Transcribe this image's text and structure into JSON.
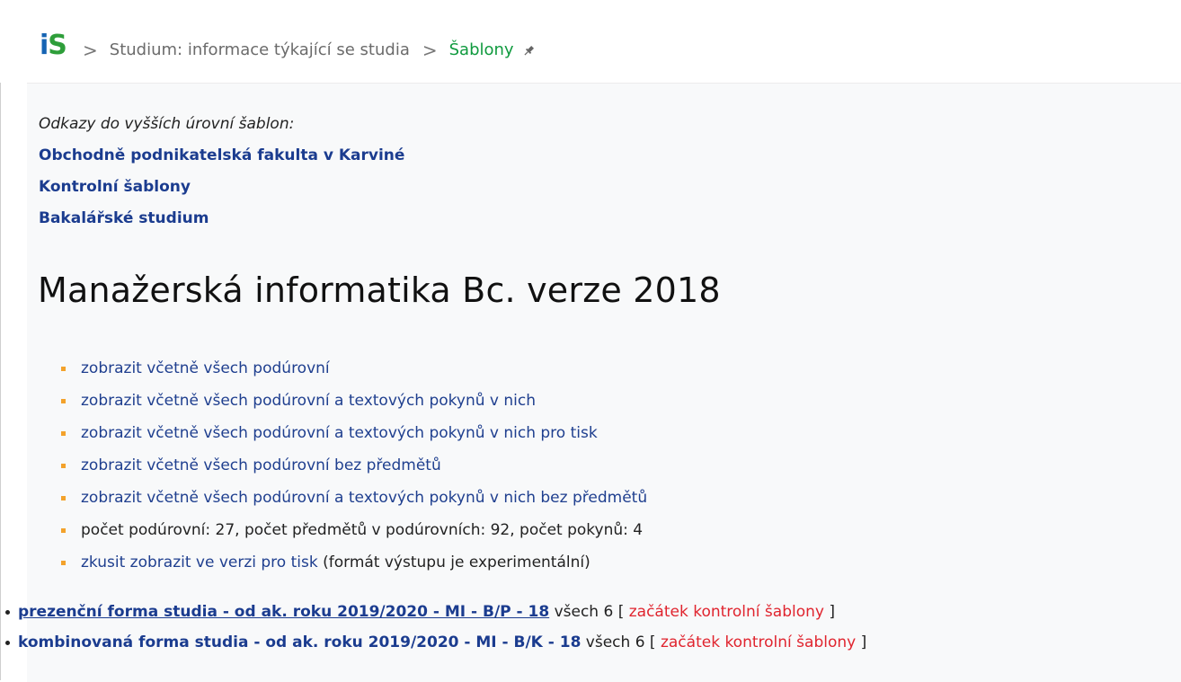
{
  "header": {
    "logo_i": "i",
    "logo_s": "S",
    "sep": ">",
    "crumb1": "Studium: informace týkající se studia",
    "crumb2": "Šablony"
  },
  "higher": {
    "title": "Odkazy do vyšších úrovní šablon:",
    "links": [
      "Obchodně podnikatelská fakulta v Karviné",
      "Kontrolní šablony",
      "Bakalářské studium"
    ]
  },
  "page_title": "Manažerská informatika Bc. verze 2018",
  "options": [
    {
      "text": "zobrazit včetně všech podúrovní"
    },
    {
      "text": "zobrazit včetně všech podúrovní a textových pokynů v nich"
    },
    {
      "text": "zobrazit včetně všech podúrovní a textových pokynů v nich pro tisk"
    },
    {
      "text": "zobrazit včetně všech podúrovní bez předmětů"
    },
    {
      "text": "zobrazit včetně všech podúrovní a textových pokynů v nich bez předmětů"
    },
    {
      "text": "počet podúrovní: 27, počet předmětů v podúrovních: 92, počet pokynů: 4"
    },
    {
      "link": "zkusit zobrazit ve verzi pro tisk",
      "note": " (formát výstupu je experimentální)"
    }
  ],
  "forms": [
    {
      "link": "prezenční forma studia - od ak. roku 2019/2020 - MI - B/P - 18",
      "count": " všech 6 [ ",
      "red": "začátek kontrolní šablony",
      "end": " ]"
    },
    {
      "link": "kombinovaná forma studia - od ak. roku 2019/2020 - MI - B/K - 18",
      "count": " všech 6 [ ",
      "red": "začátek kontrolní šablony",
      "end": " ]"
    }
  ]
}
